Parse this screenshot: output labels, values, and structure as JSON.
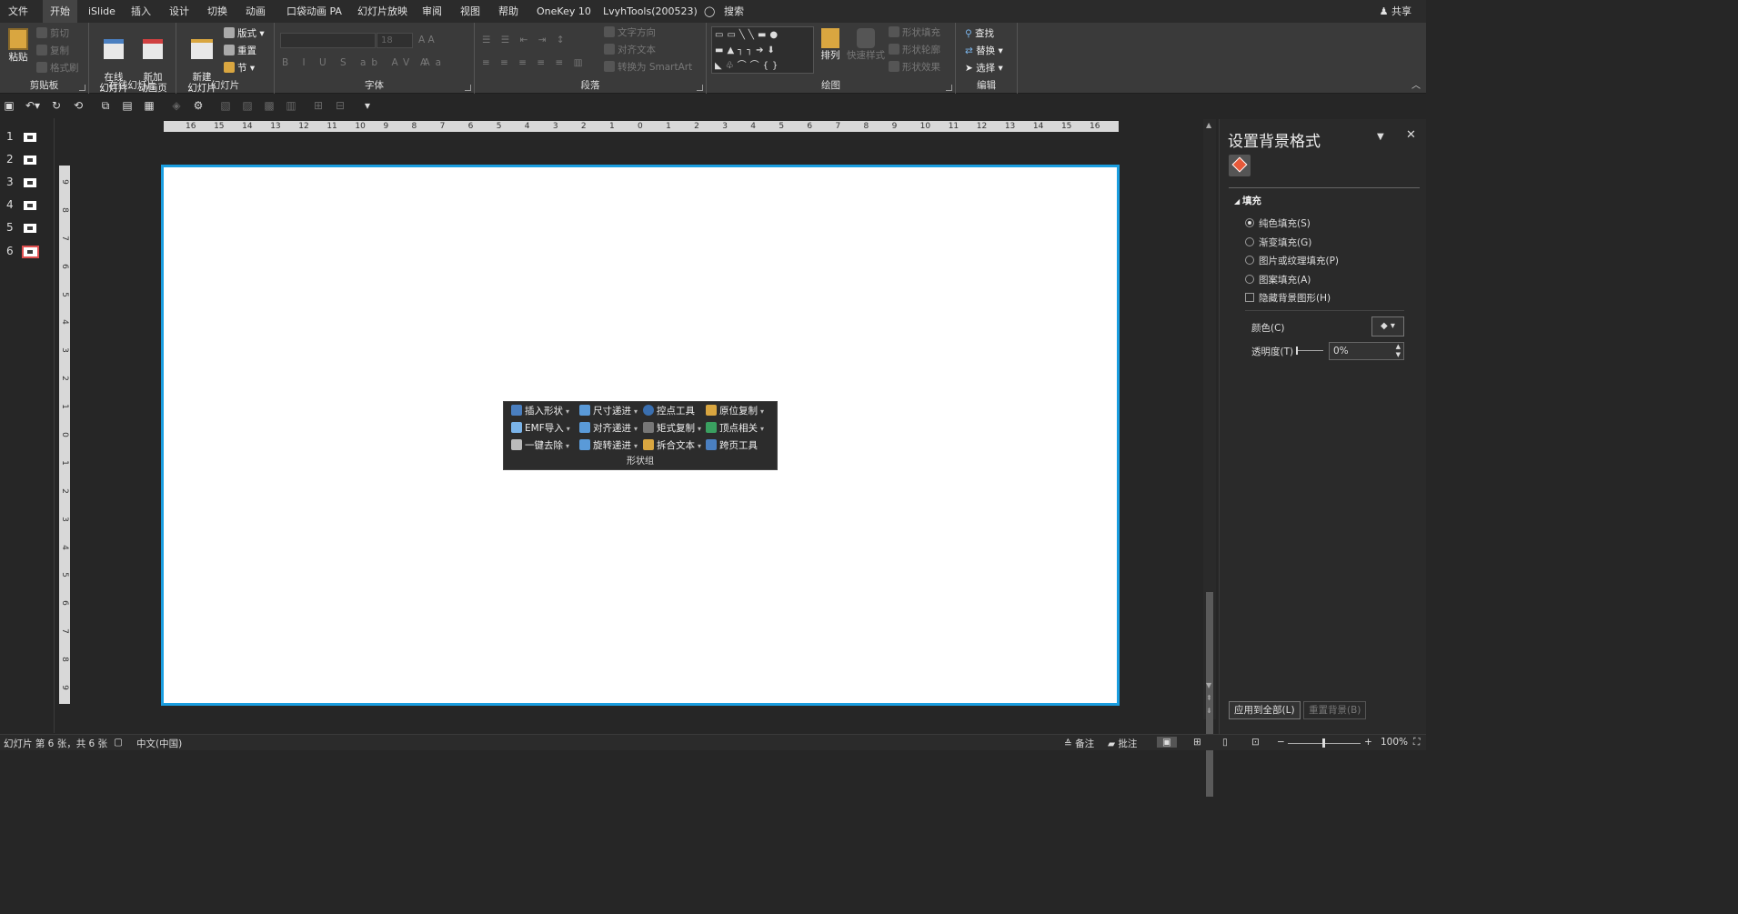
{
  "menu": {
    "tabs": [
      "文件",
      "开始",
      "iSlide",
      "插入",
      "设计",
      "切换",
      "动画",
      "口袋动画 PA",
      "幻灯片放映",
      "审阅",
      "视图",
      "帮助",
      "OneKey 10",
      "LvyhTools(200523)",
      "搜索"
    ],
    "active_tab": "开始",
    "share": "共享"
  },
  "ribbon": {
    "clipboard": {
      "paste": "粘贴",
      "cut": "剪切",
      "copy": "复制",
      "format_painter": "格式刷",
      "label": "剪贴板"
    },
    "online_slides": {
      "online": "在线\n幻灯片",
      "new_anim": "新加\n动画页",
      "label": "在线幻灯片"
    },
    "slides": {
      "new_slide": "新建\n幻灯片",
      "layout": "版式",
      "reset": "重置",
      "section": "节",
      "label": "幻灯片"
    },
    "font": {
      "font_size": "18",
      "label": "字体"
    },
    "paragraph": {
      "text_direction": "文字方向",
      "align_text": "对齐文本",
      "smartart": "转换为 SmartArt",
      "label": "段落"
    },
    "drawing": {
      "arrange": "排列",
      "quick_styles": "快速样式",
      "shape_fill": "形状填充",
      "shape_outline": "形状轮廓",
      "shape_effects": "形状效果",
      "label": "绘图"
    },
    "editing": {
      "find": "查找",
      "replace": "替换",
      "select": "选择",
      "label": "编辑"
    }
  },
  "thumbnails": [
    "1",
    "2",
    "3",
    "4",
    "5",
    "6"
  ],
  "selected_slide": "6",
  "rulers": {
    "h": [
      "16",
      "15",
      "14",
      "13",
      "12",
      "11",
      "10",
      "9",
      "8",
      "7",
      "6",
      "5",
      "4",
      "3",
      "2",
      "1",
      "0",
      "1",
      "2",
      "3",
      "4",
      "5",
      "6",
      "7",
      "8",
      "9",
      "10",
      "11",
      "12",
      "13",
      "14",
      "15",
      "16"
    ],
    "v": [
      "9",
      "8",
      "7",
      "6",
      "5",
      "4",
      "3",
      "2",
      "1",
      "0",
      "1",
      "2",
      "3",
      "4",
      "5",
      "6",
      "7",
      "8",
      "9"
    ]
  },
  "shape_panel": {
    "items": [
      [
        "插入形状",
        "尺寸递进",
        "控点工具",
        "原位复制"
      ],
      [
        "EMF导入",
        "对齐递进",
        "矩式复制",
        "顶点相关"
      ],
      [
        "一键去除",
        "旋转递进",
        "拆合文本",
        "跨页工具"
      ]
    ],
    "label": "形状组"
  },
  "pane": {
    "title": "设置背景格式",
    "section": "填充",
    "options": [
      "纯色填充(S)",
      "渐变填充(G)",
      "图片或纹理填充(P)",
      "图案填充(A)"
    ],
    "selected_option": "纯色填充(S)",
    "hide_bg": "隐藏背景图形(H)",
    "color_label": "颜色(C)",
    "transparency_label": "透明度(T)",
    "transparency_value": "0%",
    "apply_all": "应用到全部(L)",
    "reset_bg": "重置背景(B)"
  },
  "status": {
    "slide_info": "幻灯片 第 6 张，共 6 张",
    "language": "中文(中国)",
    "notes": "备注",
    "comments": "批注",
    "zoom": "100%"
  },
  "colors": {
    "accent": "#1a9ee0",
    "selected_thumb": "#e05050"
  }
}
